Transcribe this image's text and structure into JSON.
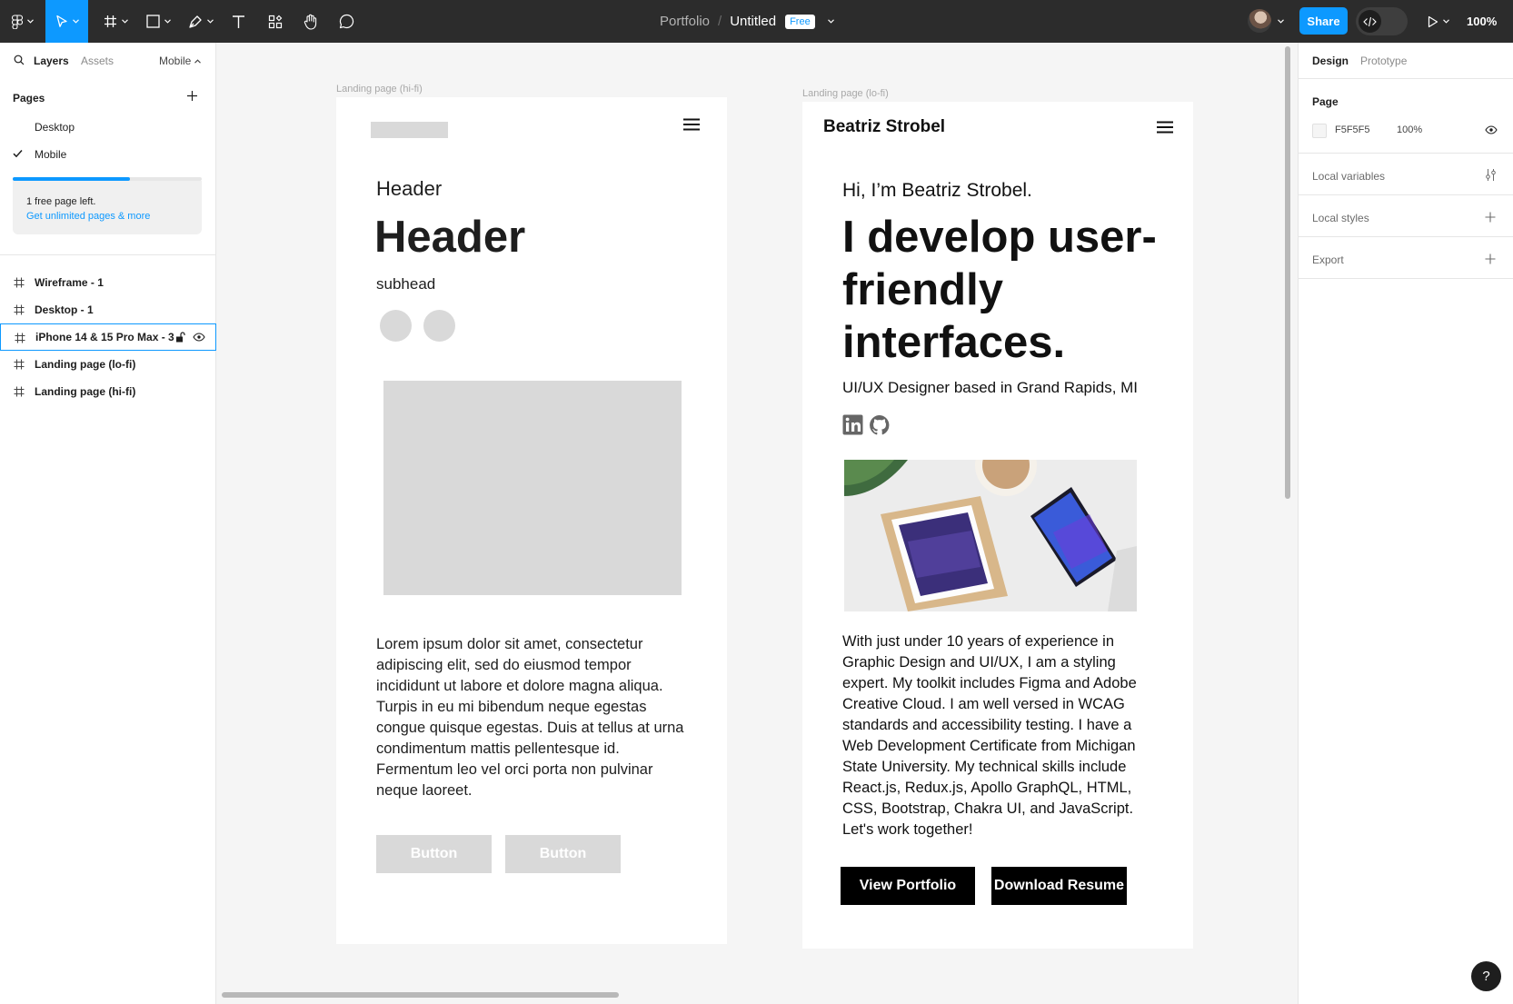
{
  "toolbar": {
    "project": "Portfolio",
    "separator": "/",
    "file_name": "Untitled",
    "plan_badge": "Free",
    "share_label": "Share",
    "zoom": "100%",
    "icons": [
      "figma-menu-icon",
      "move-tool-icon",
      "frame-tool-icon",
      "shape-tool-icon",
      "pen-tool-icon",
      "text-tool-icon",
      "resources-icon",
      "hand-tool-icon",
      "comment-tool-icon",
      "dev-mode-icon",
      "present-icon"
    ]
  },
  "left_panel": {
    "tabs": {
      "layers": "Layers",
      "assets": "Assets"
    },
    "current_page": "Mobile",
    "pages_title": "Pages",
    "pages": [
      {
        "label": "Desktop",
        "selected": false
      },
      {
        "label": "Mobile",
        "selected": true
      }
    ],
    "page_quota_fraction": 0.62,
    "upgrade": {
      "message": "1 free page left.",
      "link": "Get unlimited pages & more"
    },
    "layers": [
      {
        "label": "Wireframe - 1",
        "selected": false
      },
      {
        "label": "Desktop - 1",
        "selected": false
      },
      {
        "label": "iPhone 14 & 15 Pro Max - 3",
        "selected": true
      },
      {
        "label": "Landing page (lo-fi)",
        "selected": false
      },
      {
        "label": "Landing page (hi-fi)",
        "selected": false
      }
    ]
  },
  "canvas": {
    "hifi": {
      "label": "Landing page (hi-fi)",
      "header_small": "Header",
      "header_big": "Header",
      "subhead": "subhead",
      "body": "Lorem ipsum dolor sit amet, consectetur adipiscing elit, sed do eiusmod tempor incididunt ut labore et dolore magna aliqua. Turpis in eu mi bibendum neque egestas congue quisque egestas. Duis at tellus at urna condimentum mattis pellentesque id. Fermentum leo vel orci porta non pulvinar neque laoreet.",
      "button_1": "Button",
      "button_2": "Button"
    },
    "lofi": {
      "label": "Landing page (lo-fi)",
      "name": "Beatriz Strobel",
      "greeting": "Hi, I’m Beatriz Strobel.",
      "headline": "I develop user-friendly interfaces.",
      "role": "UI/UX Designer based in Grand Rapids, MI",
      "body": "With just under 10 years of experience in Graphic Design and UI/UX, I am a styling expert. My toolkit includes Figma and Adobe Creative Cloud. I am well versed in WCAG standards and accessibility testing. I have a Web Development Certificate from Michigan State University. My technical skills include React.js, Redux.js, Apollo GraphQL, HTML, CSS, Bootstrap, Chakra UI, and JavaScript. Let's work together!",
      "button_portfolio": "View Portfolio",
      "button_resume": "Download Resume"
    }
  },
  "right_panel": {
    "tabs": {
      "design": "Design",
      "prototype": "Prototype"
    },
    "page_title": "Page",
    "page_color": "F5F5F5",
    "page_opacity": "100%",
    "local_variables": "Local variables",
    "local_styles": "Local styles",
    "export": "Export"
  },
  "help": "?",
  "colors": {
    "accent": "#0d99ff",
    "toolbar_bg": "#2c2c2c",
    "canvas_bg": "#f5f5f5",
    "placeholder": "#d9d9d9"
  }
}
